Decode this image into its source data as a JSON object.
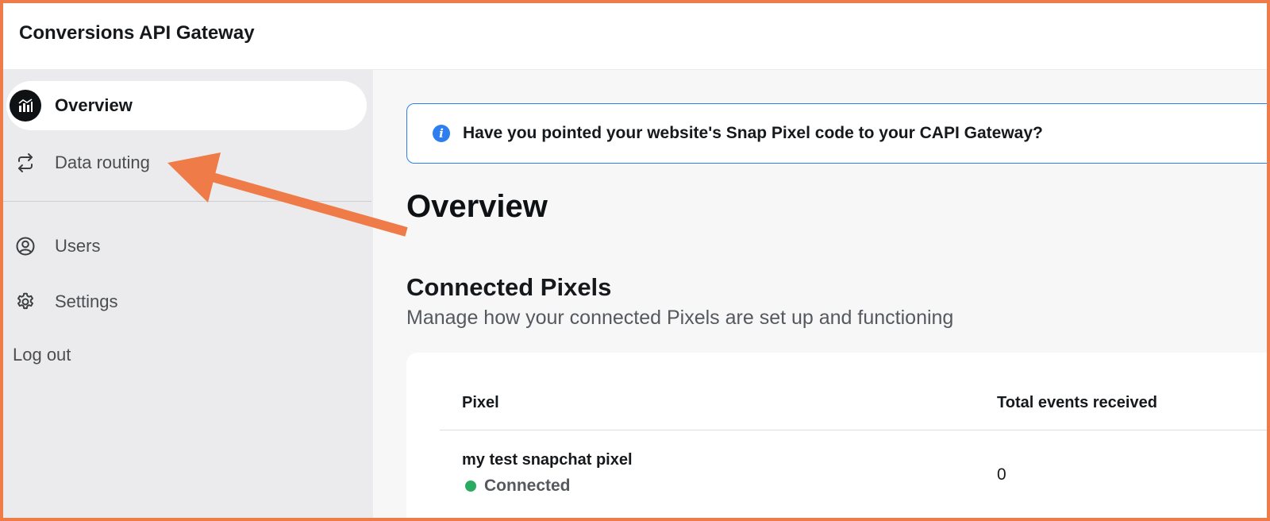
{
  "app": {
    "title": "Conversions API Gateway"
  },
  "sidebar": {
    "items": [
      {
        "label": "Overview",
        "icon": "chart-icon",
        "active": true
      },
      {
        "label": "Data routing",
        "icon": "routing-icon",
        "active": false
      },
      {
        "label": "Users",
        "icon": "user-icon",
        "active": false
      },
      {
        "label": "Settings",
        "icon": "gear-icon",
        "active": false
      }
    ],
    "logout_label": "Log out"
  },
  "banner": {
    "text": "Have you pointed your website's Snap Pixel code to your CAPI Gateway?",
    "icon": "info-icon"
  },
  "main": {
    "title": "Overview",
    "section_title": "Connected Pixels",
    "section_subtitle": "Manage how your connected Pixels are set up and functioning"
  },
  "table": {
    "columns": [
      "Pixel",
      "Total events received"
    ],
    "rows": [
      {
        "pixel": "my test snapchat pixel",
        "status": "Connected",
        "events": "0"
      }
    ]
  },
  "colors": {
    "accent": "#2d7ff0",
    "annotation": "#ee7b48",
    "status_connected": "#2bab62"
  }
}
